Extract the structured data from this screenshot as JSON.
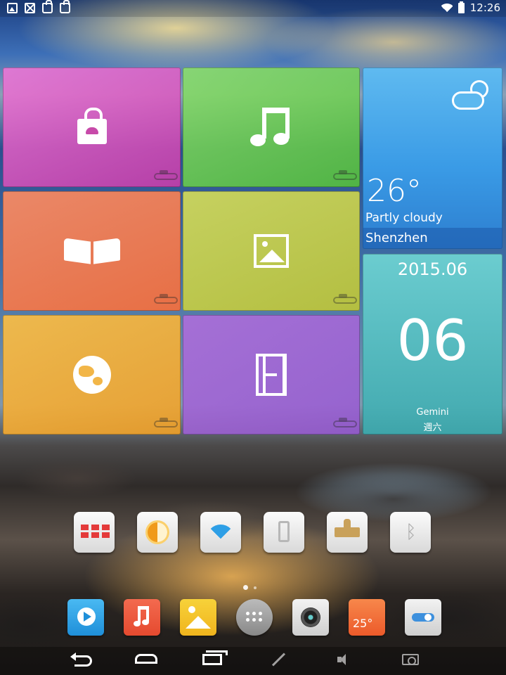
{
  "status_bar": {
    "time": "12:26",
    "notification_icons": [
      "gallery-icon",
      "blocked-icon",
      "store-icon",
      "screenshot-icon"
    ],
    "wifi_icon": "wifi-icon",
    "battery_icon": "battery-icon"
  },
  "tiles": [
    {
      "name": "store",
      "icon": "shopping-bag-icon",
      "color": "#d656b9"
    },
    {
      "name": "music",
      "icon": "music-note-icon",
      "color": "#6fcf4c"
    },
    {
      "name": "books",
      "icon": "open-book-icon",
      "color": "#f47a4a"
    },
    {
      "name": "gallery",
      "icon": "picture-icon",
      "color": "#c8cf46"
    },
    {
      "name": "browser",
      "icon": "globe-icon",
      "color": "#f5b138"
    },
    {
      "name": "video",
      "icon": "film-icon",
      "color": "#a56cd6"
    }
  ],
  "weather": {
    "temperature": "26°",
    "condition": "Partly cloudy",
    "city": "Shenzhen",
    "icon": "sun-cloud-icon"
  },
  "date_widget": {
    "year_month": "2015.06",
    "day": "06",
    "zodiac": "Gemini",
    "weekday": "週六"
  },
  "quick_toggles": [
    "keyboard-icon",
    "brightness-icon",
    "wifi-icon",
    "vibrate-icon",
    "lock-icon",
    "bluetooth-icon"
  ],
  "page_indicator": {
    "pages": 2,
    "current": 1
  },
  "dock": {
    "items": [
      "video-player-icon",
      "music-player-icon",
      "gallery-icon",
      "app-drawer-icon",
      "camera-icon",
      "weather-icon",
      "settings-icon"
    ],
    "weather_temp": "25°"
  },
  "nav_bar": [
    "back-icon",
    "home-icon",
    "recent-apps-icon",
    "expand-icon",
    "volume-icon",
    "screenshot-icon"
  ]
}
